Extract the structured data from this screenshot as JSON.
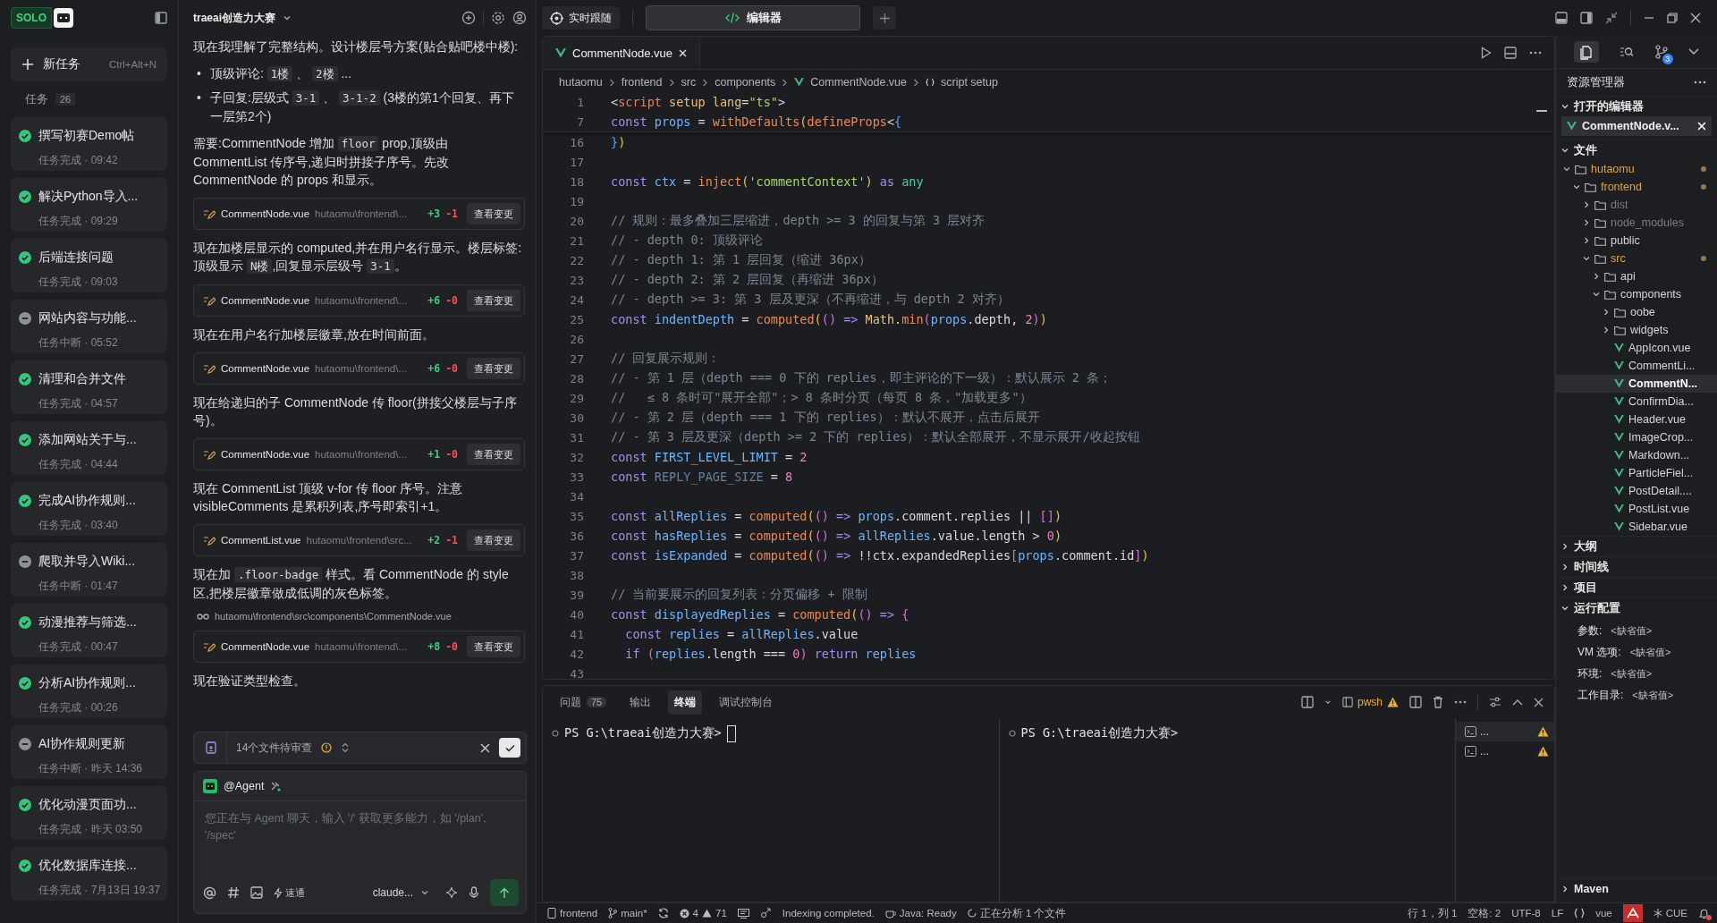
{
  "sidebar": {
    "logo": "SOLO",
    "new_task": {
      "label": "新任务",
      "shortcut": "Ctrl+Alt+N"
    },
    "tasks_label": "任务",
    "tasks_count": "26",
    "tasks": [
      {
        "title": "撰写初赛Demo帖",
        "status": "任务完成 · 09:42",
        "kind": "done"
      },
      {
        "title": "解决Python导入...",
        "status": "任务完成 · 09:29",
        "kind": "done"
      },
      {
        "title": "后端连接问题",
        "status": "任务完成 · 09:03",
        "kind": "done"
      },
      {
        "title": "网站内容与功能...",
        "status": "任务中断 · 05:52",
        "kind": "interrupted"
      },
      {
        "title": "清理和合并文件",
        "status": "任务完成 · 04:57",
        "kind": "done"
      },
      {
        "title": "添加网站关于与...",
        "status": "任务完成 · 04:44",
        "kind": "done"
      },
      {
        "title": "完成AI协作规则...",
        "status": "任务完成 · 03:40",
        "kind": "done"
      },
      {
        "title": "爬取并导入Wiki...",
        "status": "任务中断 · 01:47",
        "kind": "interrupted"
      },
      {
        "title": "动漫推荐与筛选...",
        "status": "任务完成 · 00:47",
        "kind": "done"
      },
      {
        "title": "分析AI协作规则...",
        "status": "任务完成 · 00:26",
        "kind": "done"
      },
      {
        "title": "AI协作规则更新",
        "status": "任务中断 · 昨天 14:36",
        "kind": "interrupted"
      },
      {
        "title": "优化动漫页面功...",
        "status": "任务完成 · 昨天 03:50",
        "kind": "done"
      },
      {
        "title": "优化数据库连接...",
        "status": "任务完成 · 7月13日 19:37",
        "kind": "done"
      }
    ]
  },
  "chat": {
    "title": "traeai创造力大赛",
    "messages": [
      {
        "kind": "text",
        "segs": [
          {
            "text": "现在我理解了完整结构。设计楼层号方案(贴合贴吧楼中楼):",
            "kind": "prose"
          }
        ]
      },
      {
        "kind": "bullets",
        "items": [
          {
            "marker": "•",
            "segs": [
              {
                "text": "顶级评论: ",
                "kind": "prose"
              },
              {
                "text": "1楼",
                "kind": "code"
              },
              {
                "text": " 、 ",
                "kind": "prose"
              },
              {
                "text": "2楼",
                "kind": "code"
              },
              {
                "text": " ...",
                "kind": "prose"
              }
            ]
          },
          {
            "marker": "•",
            "segs": [
              {
                "text": "子回复:层级式 ",
                "kind": "prose"
              },
              {
                "text": "3-1",
                "kind": "code"
              },
              {
                "text": " 、 ",
                "kind": "prose"
              },
              {
                "text": "3-1-2",
                "kind": "code"
              },
              {
                "text": " (3楼的第1个回复、再下一层第2个)",
                "kind": "prose"
              }
            ]
          }
        ]
      },
      {
        "kind": "text",
        "segs": [
          {
            "text": "需要:CommentNode 增加 ",
            "kind": "prose"
          },
          {
            "text": "floor",
            "kind": "code"
          },
          {
            "text": " prop,顶级由 CommentList 传序号,递归时拼接子序号。先改 CommentNode 的 props 和显示。",
            "kind": "prose"
          }
        ]
      },
      {
        "kind": "file",
        "file": "CommentNode.vue",
        "path": "hutaomu\\frontend\\...",
        "added": "+3",
        "removed": "-1",
        "button": "查看变更"
      },
      {
        "kind": "text",
        "segs": [
          {
            "text": "现在加楼层显示的 computed,并在用户名行显示。楼层标签:顶级显示 ",
            "kind": "prose"
          },
          {
            "text": "N楼",
            "kind": "code"
          },
          {
            "text": ",回复显示层级号 ",
            "kind": "prose"
          },
          {
            "text": "3-1",
            "kind": "code"
          },
          {
            "text": "。",
            "kind": "prose"
          }
        ]
      },
      {
        "kind": "file",
        "file": "CommentNode.vue",
        "path": "hutaomu\\frontend\\...",
        "added": "+6",
        "removed": "-0",
        "button": "查看变更"
      },
      {
        "kind": "text",
        "segs": [
          {
            "text": "现在在用户名行加楼层徽章,放在时间前面。",
            "kind": "prose"
          }
        ]
      },
      {
        "kind": "file",
        "file": "CommentNode.vue",
        "path": "hutaomu\\frontend\\...",
        "added": "+6",
        "removed": "-0",
        "button": "查看变更"
      },
      {
        "kind": "text",
        "segs": [
          {
            "text": "现在给递归的子 CommentNode 传 floor(拼接父楼层与子序号)。",
            "kind": "prose"
          }
        ]
      },
      {
        "kind": "file",
        "file": "CommentNode.vue",
        "path": "hutaomu\\frontend\\...",
        "added": "+1",
        "removed": "-0",
        "button": "查看变更"
      },
      {
        "kind": "text",
        "segs": [
          {
            "text": "现在 CommentList 顶级 v-for 传 floor 序号。注意 visibleComments 是累积列表,序号即索引+1。",
            "kind": "prose"
          }
        ]
      },
      {
        "kind": "file",
        "file": "CommentList.vue",
        "path": "hutaomu\\frontend\\src...",
        "added": "+2",
        "removed": "-1",
        "button": "查看变更"
      },
      {
        "kind": "text",
        "segs": [
          {
            "text": "现在加 ",
            "kind": "prose"
          },
          {
            "text": ".floor-badge",
            "kind": "code"
          },
          {
            "text": " 样式。看 CommentNode 的 style 区,把楼层徽章做成低调的灰色标签。",
            "kind": "prose"
          }
        ]
      },
      {
        "kind": "path",
        "path": "hutaomu\\frontend\\src\\components\\CommentNode.vue"
      },
      {
        "kind": "file",
        "file": "CommentNode.vue",
        "path": "hutaomu\\frontend\\...",
        "added": "+8",
        "removed": "-0",
        "button": "查看变更"
      },
      {
        "kind": "text",
        "segs": [
          {
            "text": "现在验证类型检查。",
            "kind": "prose"
          }
        ]
      }
    ],
    "review": {
      "label": "14个文件待审查"
    },
    "composer": {
      "agent": "@Agent",
      "placeholder": "您正在与 Agent 聊天，输入 '/' 获取更多能力，如 '/plan', '/spec'",
      "mode": "速通",
      "model": "claude..."
    }
  },
  "topbar": {
    "follow": "实时跟随",
    "tabs": [
      {
        "label": "编辑器",
        "selected": true
      }
    ]
  },
  "editor": {
    "tabs": [
      {
        "label": "CommentNode.vue",
        "selected": true
      }
    ],
    "breadcrumb": [
      "hutaomu",
      "frontend",
      "src",
      "components",
      "CommentNode.vue",
      "script setup"
    ],
    "sticky_lines": [
      {
        "n": "1",
        "tk": [
          {
            "text": "<",
            "kind": "plain"
          },
          {
            "text": "script",
            "kind": "tag"
          },
          {
            "text": " setup lang",
            "kind": "attribute"
          },
          {
            "text": "=",
            "kind": "plain"
          },
          {
            "text": "\"ts\"",
            "kind": "string"
          },
          {
            "text": ">",
            "kind": "plain"
          }
        ]
      },
      {
        "n": "7",
        "tk": [
          {
            "text": "const ",
            "kind": "keyword"
          },
          {
            "text": "props",
            "kind": "variable"
          },
          {
            "text": " = ",
            "kind": "plain"
          },
          {
            "text": "withDefaults",
            "kind": "function"
          },
          {
            "text": "(",
            "kind": "bracket"
          },
          {
            "text": "defineProps",
            "kind": "function"
          },
          {
            "text": "<",
            "kind": "plain"
          },
          {
            "text": "{",
            "kind": "bracket3"
          }
        ]
      }
    ],
    "lines": [
      {
        "n": "16",
        "tk": [
          {
            "text": "}",
            "kind": "bracket3"
          },
          {
            "text": ")",
            "kind": "bracket"
          }
        ]
      },
      {
        "n": "17"
      },
      {
        "n": "18",
        "tk": [
          {
            "text": "const ",
            "kind": "keyword"
          },
          {
            "text": "ctx",
            "kind": "variable"
          },
          {
            "text": " = ",
            "kind": "plain"
          },
          {
            "text": "inject",
            "kind": "function"
          },
          {
            "text": "(",
            "kind": "bracket"
          },
          {
            "text": "'commentContext'",
            "kind": "string"
          },
          {
            "text": ")",
            "kind": "bracket"
          },
          {
            "text": " as ",
            "kind": "keyword"
          },
          {
            "text": "any",
            "kind": "type"
          }
        ]
      },
      {
        "n": "19"
      },
      {
        "n": "20",
        "tk": [
          {
            "text": "// 规则：最多叠加三层缩进，depth >= 3 的回复与第 3 层对齐",
            "kind": "comment"
          }
        ]
      },
      {
        "n": "21",
        "tk": [
          {
            "text": "// - depth 0: 顶级评论",
            "kind": "comment"
          }
        ]
      },
      {
        "n": "22",
        "tk": [
          {
            "text": "// - depth 1: 第 1 层回复（缩进 36px）",
            "kind": "comment"
          }
        ]
      },
      {
        "n": "23",
        "tk": [
          {
            "text": "// - depth 2: 第 2 层回复（再缩进 36px）",
            "kind": "comment"
          }
        ]
      },
      {
        "n": "24",
        "tk": [
          {
            "text": "// - depth >= 3: 第 3 层及更深（不再缩进，与 depth 2 对齐）",
            "kind": "comment"
          }
        ]
      },
      {
        "n": "25",
        "tk": [
          {
            "text": "const ",
            "kind": "keyword"
          },
          {
            "text": "indentDepth",
            "kind": "variable"
          },
          {
            "text": " = ",
            "kind": "plain"
          },
          {
            "text": "computed",
            "kind": "function"
          },
          {
            "text": "(",
            "kind": "bracket"
          },
          {
            "text": "()",
            "kind": "bracket2"
          },
          {
            "text": " => ",
            "kind": "keyword"
          },
          {
            "text": "Math",
            "kind": "builtin"
          },
          {
            "text": ".",
            "kind": "plain"
          },
          {
            "text": "min",
            "kind": "function"
          },
          {
            "text": "(",
            "kind": "bracket2"
          },
          {
            "text": "props",
            "kind": "variable"
          },
          {
            "text": ".depth, ",
            "kind": "plain"
          },
          {
            "text": "2",
            "kind": "number"
          },
          {
            "text": ")",
            "kind": "bracket2"
          },
          {
            "text": ")",
            "kind": "bracket"
          }
        ]
      },
      {
        "n": "26"
      },
      {
        "n": "27",
        "tk": [
          {
            "text": "// 回复展示规则：",
            "kind": "comment"
          }
        ]
      },
      {
        "n": "28",
        "tk": [
          {
            "text": "// - 第 1 层（depth === 0 下的 replies，即主评论的下一级）：默认展示 2 条；",
            "kind": "comment"
          }
        ]
      },
      {
        "n": "29",
        "tk": [
          {
            "text": "//   ≤ 8 条时可\"展开全部\"；> 8 条时分页（每页 8 条，\"加载更多\"）",
            "kind": "comment"
          }
        ]
      },
      {
        "n": "30",
        "tk": [
          {
            "text": "// - 第 2 层（depth === 1 下的 replies）：默认不展开，点击后展开",
            "kind": "comment"
          }
        ]
      },
      {
        "n": "31",
        "tk": [
          {
            "text": "// - 第 3 层及更深（depth >= 2 下的 replies）：默认全部展开，不显示展开/收起按钮",
            "kind": "comment"
          }
        ]
      },
      {
        "n": "32",
        "tk": [
          {
            "text": "const ",
            "kind": "keyword"
          },
          {
            "text": "FIRST_LEVEL_LIMIT",
            "kind": "variable"
          },
          {
            "text": " = ",
            "kind": "plain"
          },
          {
            "text": "2",
            "kind": "number"
          }
        ]
      },
      {
        "n": "33",
        "tk": [
          {
            "text": "const ",
            "kind": "keyword"
          },
          {
            "text": "REPLY_PAGE_SIZE",
            "kind": "unused"
          },
          {
            "text": " = ",
            "kind": "plain"
          },
          {
            "text": "8",
            "kind": "number"
          }
        ]
      },
      {
        "n": "34"
      },
      {
        "n": "35",
        "tk": [
          {
            "text": "const ",
            "kind": "keyword"
          },
          {
            "text": "allReplies",
            "kind": "variable"
          },
          {
            "text": " = ",
            "kind": "plain"
          },
          {
            "text": "computed",
            "kind": "function"
          },
          {
            "text": "(",
            "kind": "bracket"
          },
          {
            "text": "()",
            "kind": "bracket2"
          },
          {
            "text": " => ",
            "kind": "keyword"
          },
          {
            "text": "props",
            "kind": "variable"
          },
          {
            "text": ".comment.replies || ",
            "kind": "plain"
          },
          {
            "text": "[]",
            "kind": "bracket2"
          },
          {
            "text": ")",
            "kind": "bracket"
          }
        ]
      },
      {
        "n": "36",
        "tk": [
          {
            "text": "const ",
            "kind": "keyword"
          },
          {
            "text": "hasReplies",
            "kind": "variable"
          },
          {
            "text": " = ",
            "kind": "plain"
          },
          {
            "text": "computed",
            "kind": "function"
          },
          {
            "text": "(",
            "kind": "bracket"
          },
          {
            "text": "()",
            "kind": "bracket2"
          },
          {
            "text": " => ",
            "kind": "keyword"
          },
          {
            "text": "allReplies",
            "kind": "variable"
          },
          {
            "text": ".value.length > ",
            "kind": "plain"
          },
          {
            "text": "0",
            "kind": "number"
          },
          {
            "text": ")",
            "kind": "bracket"
          }
        ]
      },
      {
        "n": "37",
        "tk": [
          {
            "text": "const ",
            "kind": "keyword"
          },
          {
            "text": "isExpanded",
            "kind": "variable"
          },
          {
            "text": " = ",
            "kind": "plain"
          },
          {
            "text": "computed",
            "kind": "function"
          },
          {
            "text": "(",
            "kind": "bracket"
          },
          {
            "text": "()",
            "kind": "bracket2"
          },
          {
            "text": " => ",
            "kind": "keyword"
          },
          {
            "text": "!!ctx.expandedReplies",
            "kind": "plain"
          },
          {
            "text": "[",
            "kind": "bracket2"
          },
          {
            "text": "props",
            "kind": "variable"
          },
          {
            "text": ".comment.id",
            "kind": "plain"
          },
          {
            "text": "]",
            "kind": "bracket2"
          },
          {
            "text": ")",
            "kind": "bracket"
          }
        ]
      },
      {
        "n": "38"
      },
      {
        "n": "39",
        "tk": [
          {
            "text": "// 当前要展示的回复列表：分页偏移 + 限制",
            "kind": "comment"
          }
        ]
      },
      {
        "n": "40",
        "tk": [
          {
            "text": "const ",
            "kind": "keyword"
          },
          {
            "text": "displayedReplies",
            "kind": "variable"
          },
          {
            "text": " = ",
            "kind": "plain"
          },
          {
            "text": "computed",
            "kind": "function"
          },
          {
            "text": "(",
            "kind": "bracket"
          },
          {
            "text": "()",
            "kind": "bracket2"
          },
          {
            "text": " => ",
            "kind": "keyword"
          },
          {
            "text": "{",
            "kind": "bracket2"
          }
        ]
      },
      {
        "n": "41",
        "tk": [
          {
            "text": "  const ",
            "kind": "keyword"
          },
          {
            "text": "replies",
            "kind": "variable"
          },
          {
            "text": " = ",
            "kind": "plain"
          },
          {
            "text": "allReplies",
            "kind": "variable"
          },
          {
            "text": ".value",
            "kind": "plain"
          }
        ]
      },
      {
        "n": "42",
        "tk": [
          {
            "text": "  if ",
            "kind": "keyword"
          },
          {
            "text": "(",
            "kind": "bracket2"
          },
          {
            "text": "replies",
            "kind": "variable"
          },
          {
            "text": ".length === ",
            "kind": "plain"
          },
          {
            "text": "0",
            "kind": "number"
          },
          {
            "text": ")",
            "kind": "bracket2"
          },
          {
            "text": " return ",
            "kind": "keyword"
          },
          {
            "text": "replies",
            "kind": "variable"
          }
        ]
      },
      {
        "n": "43"
      }
    ]
  },
  "panel": {
    "tabs": [
      {
        "label": "问题",
        "count": "75",
        "selected": false
      },
      {
        "label": "输出",
        "selected": false
      },
      {
        "label": "终端",
        "selected": true
      },
      {
        "label": "调试控制台",
        "selected": false
      }
    ],
    "shell": "pwsh",
    "terminals": [
      {
        "prompt": "PS G:\\traeai创造力大赛>",
        "cursor": true
      },
      {
        "prompt": "PS G:\\traeai创造力大赛>",
        "cursor": false
      }
    ],
    "instances": [
      {
        "label": "..."
      },
      {
        "label": "..."
      }
    ]
  },
  "explorer": {
    "scm_badge": "3",
    "title": "资源管理器",
    "open_editors": {
      "label": "打开的编辑器",
      "expanded": true,
      "items": [
        {
          "label": "CommentNode.v..."
        }
      ]
    },
    "files_label": "文件",
    "tree": [
      {
        "label": "hutaomu",
        "kind": "folder",
        "expanded": true,
        "modified": true,
        "dimmed": false,
        "selected": false,
        "children": [
          {
            "label": "frontend",
            "kind": "folder",
            "expanded": true,
            "modified": true,
            "dimmed": false,
            "selected": false,
            "children": [
              {
                "label": "dist",
                "kind": "folder",
                "expanded": false,
                "modified": false,
                "dimmed": true,
                "selected": false
              },
              {
                "label": "node_modules",
                "kind": "folder",
                "expanded": false,
                "modified": false,
                "dimmed": true,
                "selected": false
              },
              {
                "label": "public",
                "kind": "folder",
                "expanded": false,
                "modified": false,
                "dimmed": false,
                "selected": false
              },
              {
                "label": "src",
                "kind": "folder",
                "expanded": true,
                "modified": true,
                "dimmed": false,
                "selected": false,
                "children": [
                  {
                    "label": "api",
                    "kind": "folder",
                    "expanded": false,
                    "modified": false,
                    "dimmed": false,
                    "selected": false
                  },
                  {
                    "label": "components",
                    "kind": "folder",
                    "expanded": true,
                    "modified": false,
                    "dimmed": false,
                    "selected": false,
                    "children": [
                      {
                        "label": "oobe",
                        "kind": "folder",
                        "expanded": false,
                        "modified": false,
                        "dimmed": false,
                        "selected": false
                      },
                      {
                        "label": "widgets",
                        "kind": "folder",
                        "expanded": false,
                        "modified": false,
                        "dimmed": false,
                        "selected": false
                      },
                      {
                        "label": "AppIcon.vue",
                        "kind": "file",
                        "modified": false,
                        "dimmed": false,
                        "selected": false
                      },
                      {
                        "label": "CommentLi...",
                        "kind": "file",
                        "modified": false,
                        "dimmed": false,
                        "selected": false
                      },
                      {
                        "label": "CommentN...",
                        "kind": "file",
                        "modified": false,
                        "dimmed": false,
                        "selected": true
                      },
                      {
                        "label": "ConfirmDia...",
                        "kind": "file",
                        "modified": false,
                        "dimmed": false,
                        "selected": false
                      },
                      {
                        "label": "Header.vue",
                        "kind": "file",
                        "modified": false,
                        "dimmed": false,
                        "selected": false
                      },
                      {
                        "label": "ImageCrop...",
                        "kind": "file",
                        "modified": false,
                        "dimmed": false,
                        "selected": false
                      },
                      {
                        "label": "Markdown...",
                        "kind": "file",
                        "modified": false,
                        "dimmed": false,
                        "selected": false
                      },
                      {
                        "label": "ParticleFiel...",
                        "kind": "file",
                        "modified": false,
                        "dimmed": false,
                        "selected": false
                      },
                      {
                        "label": "PostDetail....",
                        "kind": "file",
                        "modified": false,
                        "dimmed": false,
                        "selected": false
                      },
                      {
                        "label": "PostList.vue",
                        "kind": "file",
                        "modified": false,
                        "dimmed": false,
                        "selected": false
                      },
                      {
                        "label": "Sidebar.vue",
                        "kind": "file",
                        "modified": false,
                        "dimmed": false,
                        "selected": false
                      }
                    ]
                  }
                ]
              }
            ]
          }
        ]
      }
    ],
    "sections": [
      {
        "label": "大纲",
        "expanded": false
      },
      {
        "label": "时间线",
        "expanded": false
      },
      {
        "label": "项目",
        "expanded": false
      },
      {
        "label": "运行配置",
        "expanded": true
      }
    ],
    "run_config": [
      {
        "key": "参数:",
        "value": "<缺省值>"
      },
      {
        "key": "VM 选项:",
        "value": "<缺省值>"
      },
      {
        "key": "环境:",
        "value": "<缺省值>"
      },
      {
        "key": "工作目录:",
        "value": "<缺省值>"
      }
    ],
    "maven": "Maven"
  },
  "status_bar": {
    "project": "frontend",
    "branch": "main*",
    "errors": "4",
    "warnings": "71",
    "indexing": "Indexing completed.",
    "java": "Java: Ready",
    "analyzing": "正在分析 1 个文件",
    "position": "行 1，列 1",
    "indent": "空格: 2",
    "encoding": "UTF-8",
    "eol": "LF",
    "language": "vue",
    "cue": "CUE",
    "notification": true
  }
}
